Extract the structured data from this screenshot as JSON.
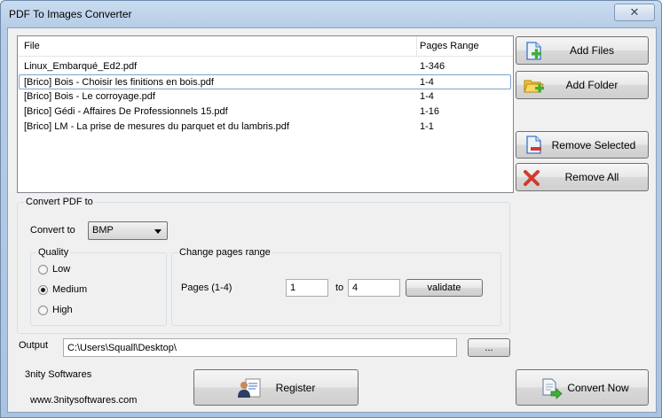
{
  "window": {
    "title": "PDF To Images Converter",
    "close_glyph": "✕"
  },
  "file_list": {
    "columns": {
      "file": "File",
      "pages_range": "Pages Range"
    },
    "rows": [
      {
        "file": "Linux_Embarqué_Ed2.pdf",
        "range": "1-346"
      },
      {
        "file": "[Brico] Bois - Choisir les finitions en bois.pdf",
        "range": "1-4"
      },
      {
        "file": "[Brico] Bois - Le corroyage.pdf",
        "range": "1-4"
      },
      {
        "file": "[Brico] Gédi - Affaires De Professionnels 15.pdf",
        "range": "1-16"
      },
      {
        "file": "[Brico] LM - La prise de mesures du parquet et du lambris.pdf",
        "range": "1-1"
      }
    ]
  },
  "side_buttons": {
    "add_files": "Add Files",
    "add_folder": "Add Folder",
    "remove_selected": "Remove Selected",
    "remove_all": "Remove All"
  },
  "convert": {
    "group_title": "Convert PDF to",
    "convert_to_label": "Convert to",
    "format_value": "BMP",
    "quality": {
      "title": "Quality",
      "options": [
        "Low",
        "Medium",
        "High"
      ],
      "selected": "Medium"
    },
    "pages_range": {
      "title": "Change pages range",
      "label": "Pages (1-4)",
      "from": "1",
      "to_label": "to",
      "to": "4",
      "validate": "validate"
    }
  },
  "output": {
    "label": "Output",
    "path": "C:\\Users\\Squall\\Desktop\\",
    "browse": "..."
  },
  "footer": {
    "company": "3nity Softwares",
    "website": "www.3nitysoftwares.com",
    "register": "Register",
    "convert_now": "Convert Now"
  },
  "colors": {
    "accent_green": "#3fae3a",
    "remove_red": "#d33a2c",
    "folder_yellow": "#f0c030",
    "doc_blue": "#3a74c4"
  }
}
